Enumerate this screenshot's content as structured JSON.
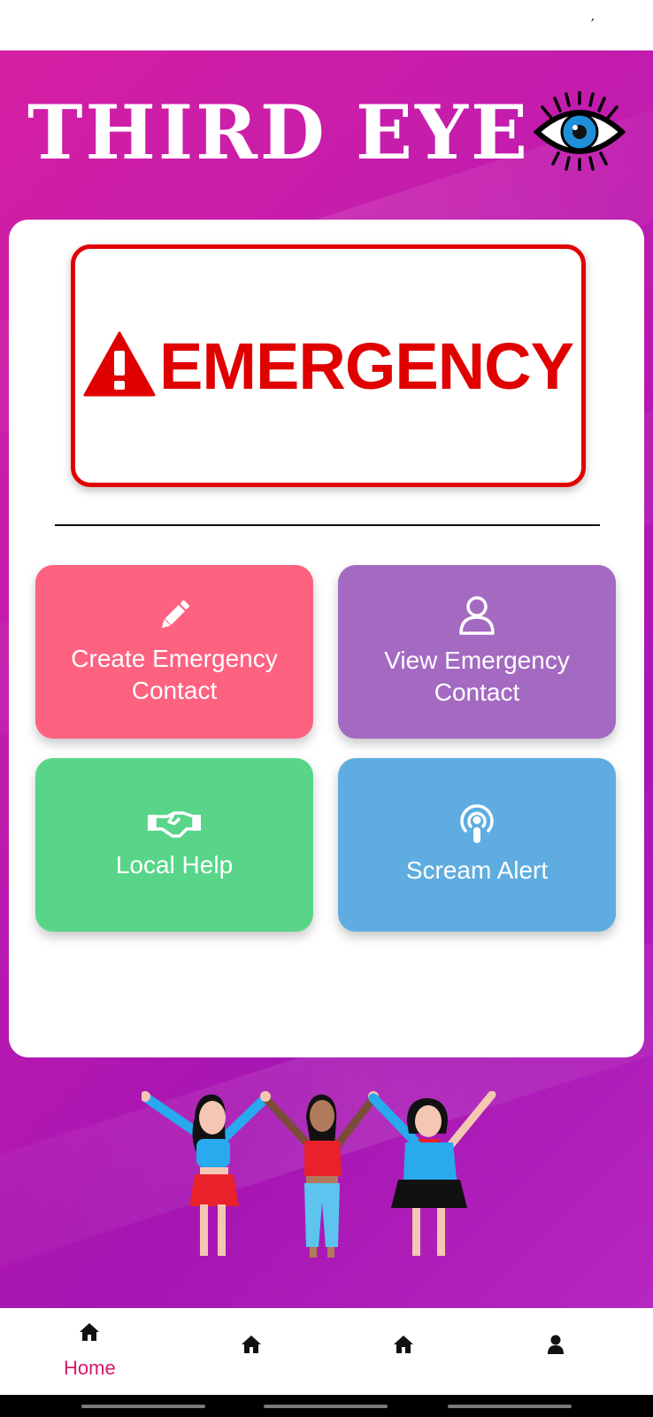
{
  "status_bar": {
    "mark": "′"
  },
  "header": {
    "title": "THIRD EYE",
    "logo_icon": "eye-icon"
  },
  "emergency": {
    "label": "EMERGENCY",
    "icon": "warning-icon",
    "color": "#e00000"
  },
  "tiles": [
    {
      "label": "Create Emergency Contact",
      "icon": "pencil-icon",
      "color": "#fe6281"
    },
    {
      "label": "View Emergency Contact",
      "icon": "user-icon",
      "color": "#a46ac2"
    },
    {
      "label": "Local Help",
      "icon": "handshake-icon",
      "color": "#58d589"
    },
    {
      "label": "Scream Alert",
      "icon": "podcast-icon",
      "color": "#5fade0"
    }
  ],
  "bottom_nav": {
    "items": [
      {
        "icon": "home-icon",
        "label": "Home",
        "active": true
      },
      {
        "icon": "home-icon",
        "label": ""
      },
      {
        "icon": "home-icon",
        "label": ""
      },
      {
        "icon": "user-icon",
        "label": ""
      }
    ],
    "active_color": "#d6196a"
  }
}
